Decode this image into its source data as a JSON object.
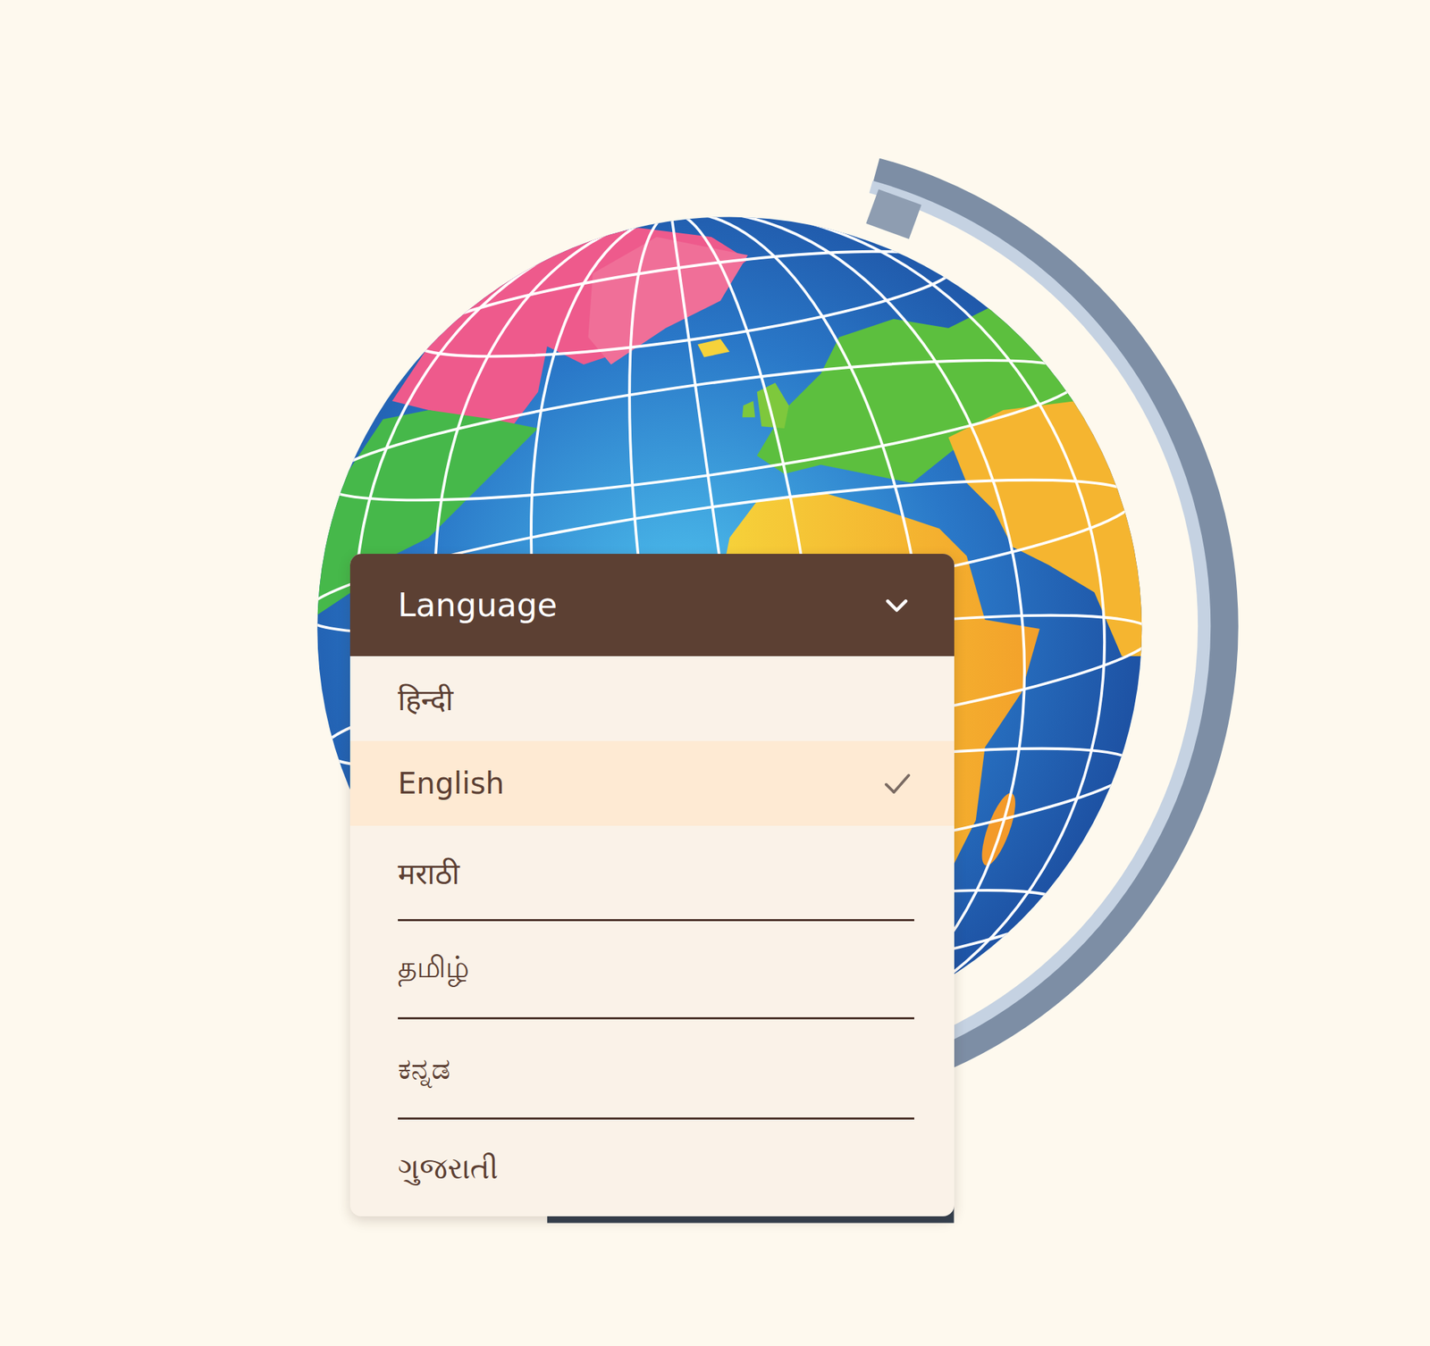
{
  "dropdown": {
    "title": "Language",
    "options": [
      {
        "label": "हिन्दी",
        "selected": false
      },
      {
        "label": "English",
        "selected": true
      },
      {
        "label": "मराठी",
        "selected": false
      },
      {
        "label": "தமிழ்",
        "selected": false
      },
      {
        "label": "ಕನ್ನಡ",
        "selected": false
      },
      {
        "label": "ગુજરાતી",
        "selected": false
      }
    ]
  }
}
